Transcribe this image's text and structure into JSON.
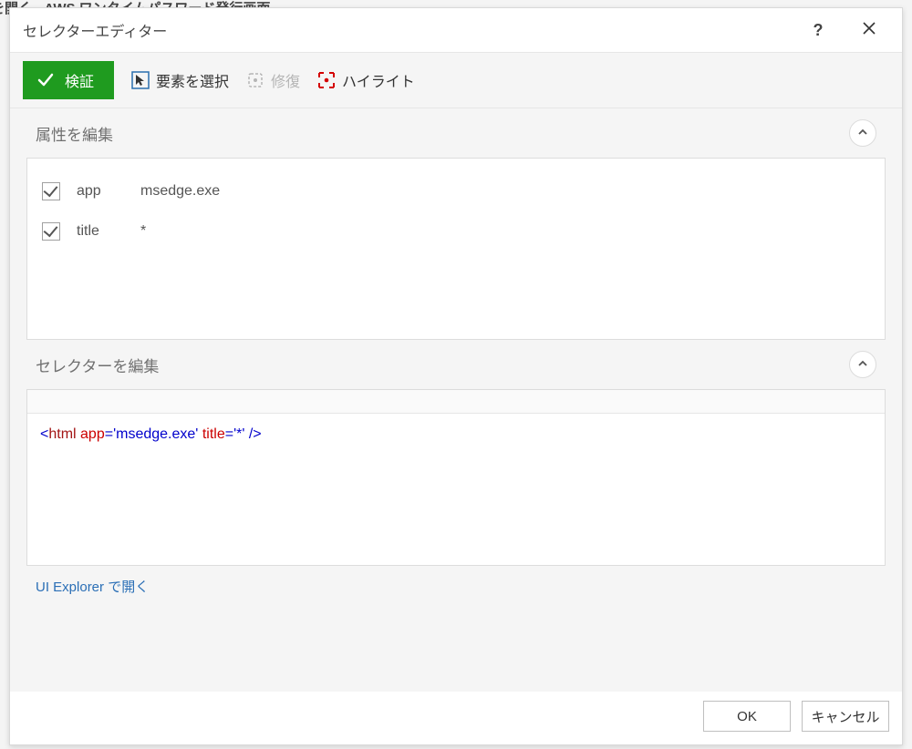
{
  "background": {
    "partial_text": "を開く - AWS ワンタイムパスワード発行画面"
  },
  "dialog": {
    "title": "セレクターエディター",
    "help_char": "?"
  },
  "toolbar": {
    "validate_label": "検証",
    "select_element_label": "要素を選択",
    "repair_label": "修復",
    "highlight_label": "ハイライト"
  },
  "sections": {
    "attributes_title": "属性を編集",
    "selector_title": "セレクターを編集"
  },
  "attributes": [
    {
      "checked": true,
      "name": "app",
      "value": "msedge.exe"
    },
    {
      "checked": true,
      "name": "title",
      "value": "*"
    }
  ],
  "selector": {
    "tag": "html",
    "attr1_name": "app",
    "attr1_value": "'msedge.exe'",
    "attr2_name": "title",
    "attr2_value": "'*'"
  },
  "footer": {
    "open_ui_explorer": "UI Explorer で開く",
    "ok": "OK",
    "cancel": "キャンセル"
  }
}
